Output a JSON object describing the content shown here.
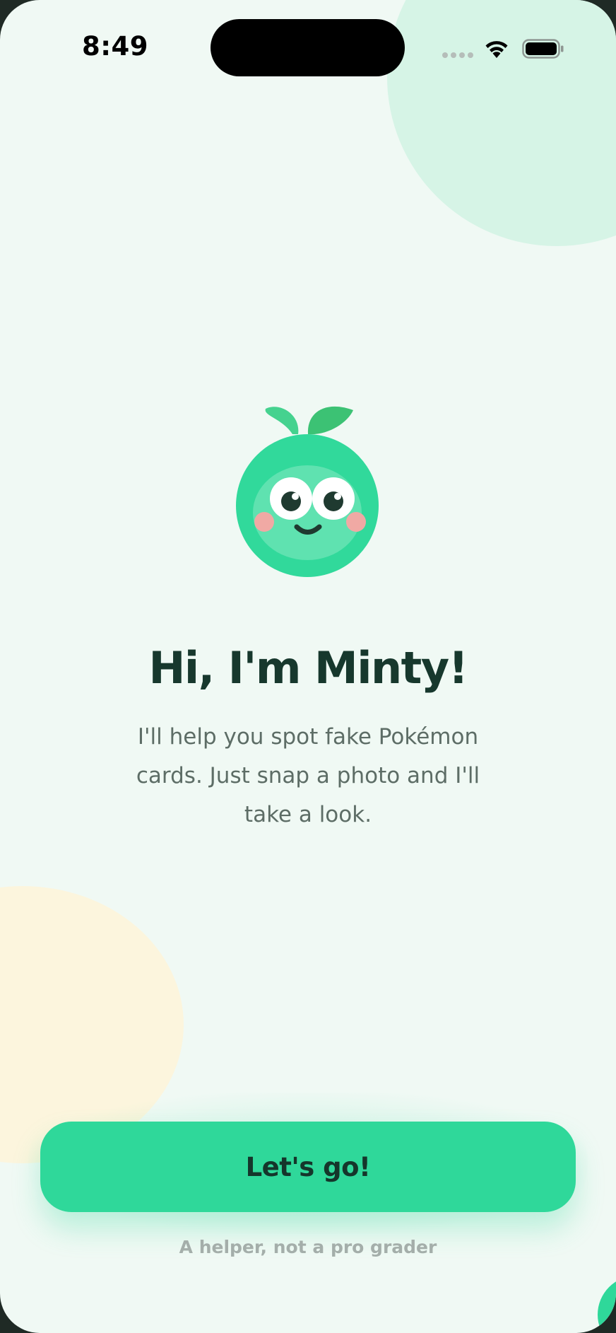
{
  "status_bar": {
    "time": "8:49",
    "icons": [
      "signal-icon",
      "wifi-icon",
      "battery-icon"
    ]
  },
  "mascot": {
    "icon": "minty-mascot-icon",
    "colors": {
      "body": "#31d99b",
      "face": "#5fe2b0",
      "leaf_left": "#45d28f",
      "leaf_right": "#3cc274",
      "cheeks": "#f0a9a4",
      "eyes": "#1f3a30"
    }
  },
  "welcome": {
    "title": "Hi, I'm Minty!",
    "description": "I'll help you spot fake Pokémon cards. Just snap a photo and I'll take a look."
  },
  "actions": {
    "primary_label": "Let's go!",
    "disclaimer": "A helper, not a pro grader"
  },
  "theme": {
    "background": "#f0f9f4",
    "accent": "#2fd89a",
    "text_dark": "#17382d",
    "text_muted": "#5d6d66",
    "blob_mint": "#d6f4e6",
    "blob_cream": "#fcf5dd"
  }
}
